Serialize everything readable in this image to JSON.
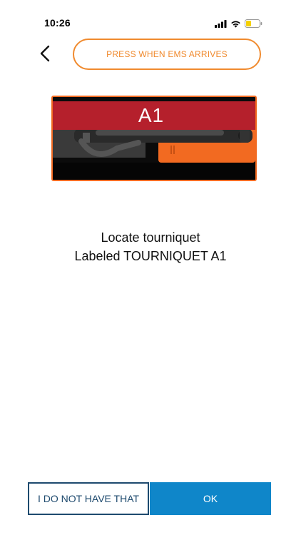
{
  "status_bar": {
    "time": "10:26",
    "battery_color": "#f5d000"
  },
  "header": {
    "back_icon": "chevron-left-icon",
    "ems_button_label": "PRESS WHEN EMS ARRIVES",
    "accent_color": "#f08a2e"
  },
  "image": {
    "band_label": "A1",
    "band_color": "#b5202c",
    "border_color": "#f26a21"
  },
  "instructions": {
    "line1": "Locate tourniquet",
    "line2": "Labeled TOURNIQUET A1"
  },
  "actions": {
    "no_label": "I DO NOT HAVE THAT",
    "ok_label": "OK",
    "ok_color": "#0f86c9",
    "no_color": "#1e4a6e"
  }
}
